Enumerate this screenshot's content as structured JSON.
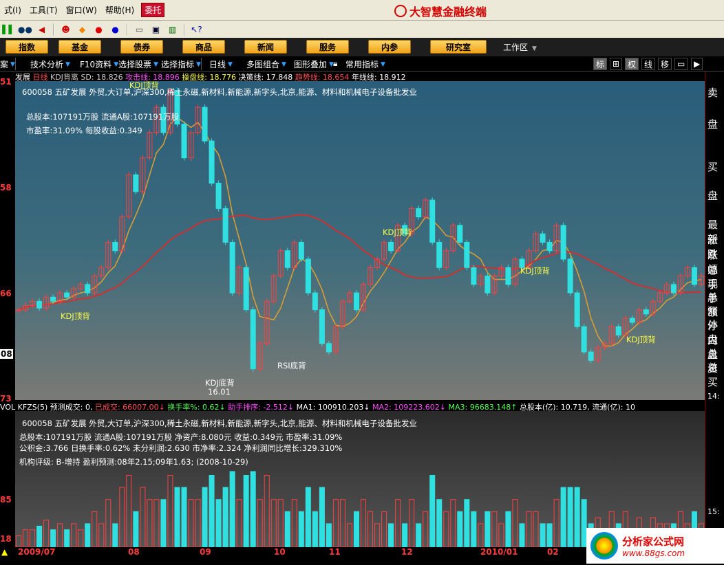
{
  "menubar": {
    "items": [
      {
        "label": "式(I)"
      },
      {
        "label": "工具(T)"
      },
      {
        "label": "窗口(W)"
      },
      {
        "label": "帮助(H)"
      }
    ],
    "trade": "委托",
    "app_title": "大智慧金融终端"
  },
  "categories": [
    "指数",
    "基金",
    "债券",
    "商品",
    "新闻",
    "服务",
    "内参",
    "研究室"
  ],
  "workarea": "工作区",
  "funcbar": {
    "left": [
      "案",
      "技术分析",
      "F10资料",
      "选择股票",
      "选择指标",
      "日线",
      "多图组合",
      "图形叠加",
      "常用指标"
    ],
    "right": [
      "标",
      "⊞",
      "权",
      "线",
      "移",
      "▭",
      "▶"
    ]
  },
  "main_info": {
    "name": "五矿发展",
    "period": "日线",
    "indicator": "KDJ背离",
    "sd": "SD: 18.826",
    "attack": "攻击线: 18.896",
    "operate": "操盘线: 18.776",
    "decision": "决策线: 17.848",
    "trend": "趋势线: 18.654",
    "year": "年线线: 18.912"
  },
  "stock_desc": "600058 五矿发展 外贸,大订单,沪深300,稀土永磁,新材料,新能源,新字头,北京,能源、材料和机械电子设备批发业",
  "main_notes": {
    "total": "总股本:107191万股 流通A股:107191万股",
    "pe": "市盈率:31.09% 每股收益:0.349"
  },
  "chart_labels": {
    "kdj_top": "KDJ顶背",
    "kdj_top2": "KDJ顶背",
    "kdj_top3": "KDJ顶背",
    "kdj_top4": "KDJ顶背",
    "kdj_top5": "KDJ顶背",
    "rsi_bottom": "RSI底背",
    "kdj_bottom": "KDJ底背",
    "low_value": "16.01"
  },
  "vol_info": {
    "title": "VOL KFZS(5)",
    "forecast": "预测成交: 0,",
    "done": "已成交: 66007.00↓",
    "turnover": "换手率%: 0.62↓",
    "boost": "助手排序: -2.512↓",
    "ma1": "MA1: 100910.203↓",
    "ma2": "MA2: 109223.602↓",
    "ma3": "MA3: 96683.148↑",
    "total_cap": "总股本(亿): 10.719,",
    "float_cap": "流通(亿): 10"
  },
  "vol_notes": {
    "line1": "总股本:107191万股 流通A股:107191万股  净资产:8.080元  收益:0.349元  市盈率:31.09%",
    "line2": "公积金:3.766  日换手率:0.62%  未分利润:2.630  市净率:2.324  净利润同比增长:329.310%",
    "line3": "机构评级: B-增持 盈利预测:08年2.15;09年1.63;  (2008-10-29)"
  },
  "left_axis": [
    "51",
    "58",
    "66",
    "08",
    "73",
    "85",
    "18"
  ],
  "time_axis": [
    "2009/07",
    "08",
    "09",
    "10",
    "11",
    "12",
    "2010/01",
    "02"
  ],
  "right_side": [
    "卖",
    "盘",
    "买",
    "盘",
    "最新",
    "涨跌",
    "涨幅",
    "总手",
    "现手",
    "总额",
    "涨停",
    "外盘",
    "内盘",
    "总资",
    "总买"
  ],
  "right_vals": [
    "14:",
    "15:"
  ],
  "watermark": {
    "t1": "分析家公式网",
    "t2": "www.88gs.com"
  },
  "chart_data": {
    "type": "candlestick",
    "price_range": [
      15.73,
      19.51
    ],
    "close": [
      16.8,
      16.85,
      16.9,
      16.82,
      16.95,
      16.9,
      17.0,
      16.95,
      17.05,
      17.1,
      17.0,
      17.2,
      17.3,
      17.6,
      17.5,
      17.9,
      18.4,
      18.2,
      18.6,
      18.9,
      19.2,
      18.9,
      19.4,
      19.0,
      18.6,
      18.9,
      19.2,
      18.8,
      18.3,
      18.0,
      17.6,
      17.0,
      17.3,
      16.8,
      16.1,
      16.4,
      16.9,
      17.2,
      17.5,
      17.3,
      17.6,
      17.4,
      17.0,
      16.8,
      16.4,
      16.3,
      16.6,
      16.9,
      17.0,
      16.8,
      17.1,
      17.3,
      17.4,
      17.6,
      17.5,
      17.8,
      17.7,
      18.0,
      17.9,
      18.1,
      17.6,
      17.3,
      17.5,
      17.8,
      17.6,
      17.3,
      17.1,
      17.2,
      17.0,
      17.2,
      17.3,
      17.1,
      17.4,
      17.3,
      17.5,
      17.7,
      17.6,
      17.5,
      17.8,
      17.4,
      17.0,
      16.6,
      16.3,
      16.2,
      16.35,
      16.4,
      16.6,
      16.5,
      16.7,
      16.65,
      16.8,
      16.75,
      16.9,
      17.0,
      17.1,
      17.0,
      17.2,
      17.3,
      17.1,
      17.2
    ]
  }
}
